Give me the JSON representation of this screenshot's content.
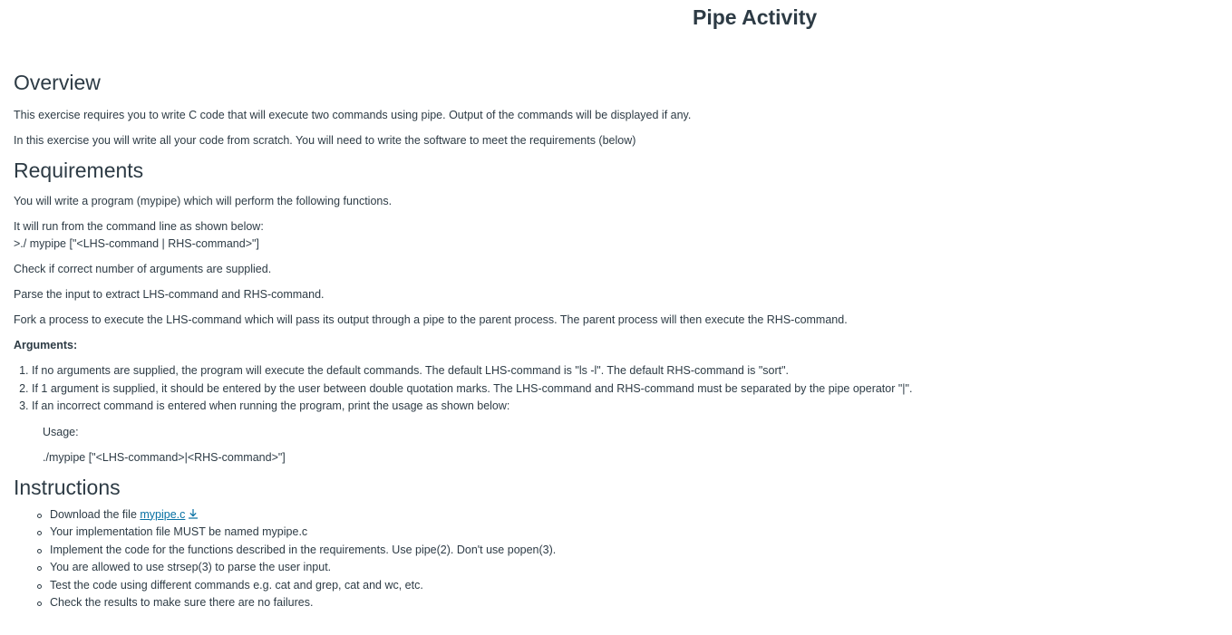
{
  "page": {
    "title": "Pipe Activity"
  },
  "overview": {
    "heading": "Overview",
    "paragraphs": [
      "This exercise requires you to write C code that will execute two commands using pipe. Output of the commands will be displayed if any.",
      "In this exercise you will write all your code from scratch. You will need to write the software to meet the requirements (below)"
    ]
  },
  "requirements": {
    "heading": "Requirements",
    "intro": "You will write a program (mypipe) which will perform the following functions.",
    "run_line_1": "It will run from the command line as shown below:",
    "run_line_2": ">./ mypipe [\"<LHS-command | RHS-command>\"]",
    "check": "Check if correct number of arguments are supplied.",
    "parse": "Parse the input to extract LHS-command and RHS-command.",
    "fork": "Fork a process to execute the LHS-command which will pass its output through a pipe to the parent process. The parent process will then execute the RHS-command.",
    "arguments_label": "Arguments:",
    "arguments": [
      "If no arguments are supplied, the program will execute the default commands. The default LHS-command is \"ls -l\". The default RHS-command is \"sort\".",
      "If 1 argument is supplied, it should be entered by the user between double quotation marks. The LHS-command and RHS-command must be separated by the pipe operator \"|\".",
      "If an incorrect command is entered when running the program, print the usage as shown below:"
    ],
    "usage_label": "Usage:",
    "usage_command": "./mypipe [\"<LHS-command>|<RHS-command>\"]"
  },
  "instructions": {
    "heading": "Instructions",
    "download_prefix": "Download the file ",
    "download_link": "mypipe.c",
    "items": [
      "Your implementation file MUST be named mypipe.c",
      "Implement the code for the functions described in the requirements.  Use pipe(2). Don't use popen(3).",
      "You are allowed to use strsep(3) to parse the user input.",
      "Test the code using different commands e.g. cat and grep, cat and wc, etc.",
      "Check the results to make sure there are no failures."
    ]
  },
  "colors": {
    "text": "#2d3b45",
    "link": "#0770a3"
  },
  "icons": {
    "download": "download-icon"
  }
}
